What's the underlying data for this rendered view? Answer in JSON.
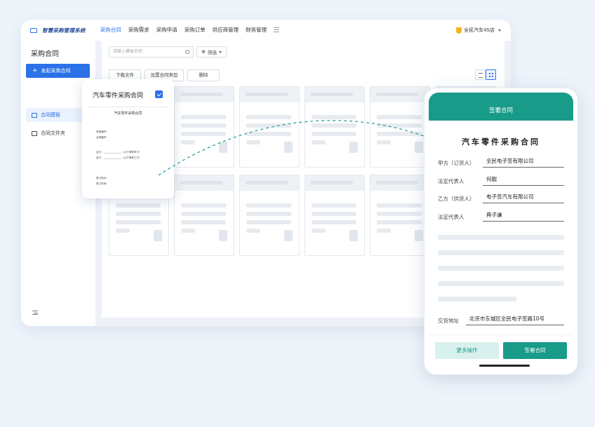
{
  "app": {
    "logo_text": "智慧采购管理系统",
    "nav": [
      "采购合同",
      "采购需求",
      "采购申请",
      "采购订单",
      "供应商管理",
      "财务管理"
    ],
    "active_nav": "采购合同",
    "store": "全民汽车4S店"
  },
  "sidebar": {
    "title": "采购合同",
    "new_button": "发起采购合同",
    "items": [
      {
        "label": "合同模板",
        "active": true
      },
      {
        "label": "合同文件夹",
        "active": false
      }
    ]
  },
  "toolbar": {
    "search_placeholder": "请输入模板名称",
    "filter_label": "筛选",
    "download_label": "下载文件",
    "set_type_label": "设置合同类型",
    "delete_label": "删除"
  },
  "template_card": {
    "title": "汽车零件采购合同",
    "checked": true,
    "doc_title": "汽车零件采购合同",
    "doc_lines": [
      "采购编号：",
      "合同编号：",
      "买方：______________（以下简称甲方）",
      "卖方：______________（以下简称乙方）",
      "签订地点：",
      "签订时间："
    ]
  },
  "phone": {
    "header": "签署合同",
    "title": "汽车零件采购合同",
    "fields": [
      {
        "label": "甲方（订货人）",
        "value": "全民电子签有限公司"
      },
      {
        "label": "法定代表人",
        "value": "何靓"
      },
      {
        "label": "乙方（供货人）",
        "value": "电子签汽车有限公司"
      },
      {
        "label": "法定代表人",
        "value": "典子谦"
      }
    ],
    "address_label": "交货地址",
    "address_value": "北京市东城区全民电子签路10号",
    "more_button": "更多操作",
    "sign_button": "签署合同"
  },
  "colors": {
    "primary_blue": "#2b71e8",
    "teal": "#199b8a",
    "background": "#eef4fa"
  }
}
